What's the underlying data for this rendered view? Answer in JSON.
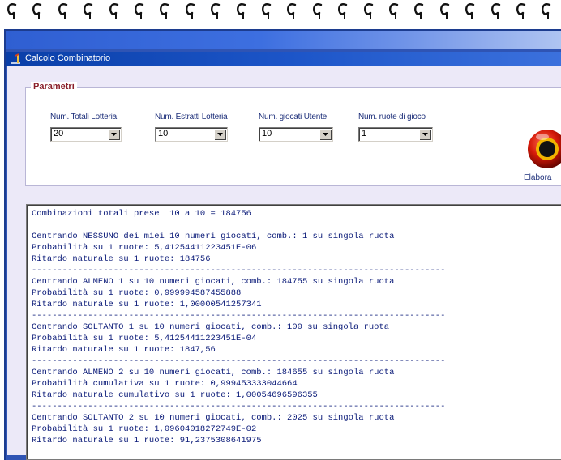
{
  "window": {
    "title": "Calcolo Combinatorio",
    "icon": "app-icon"
  },
  "params": {
    "legend": "Parametri",
    "fields": [
      {
        "label": "Num. Totali Lotteria",
        "value": "20"
      },
      {
        "label": "Num. Estratti Lotteria",
        "value": "10"
      },
      {
        "label": "Num. giocati Utente",
        "value": "10"
      },
      {
        "label": "Num. ruote di gioco",
        "value": "1"
      }
    ],
    "run_button": {
      "label": "Elabora",
      "icon": "run-orb-icon"
    }
  },
  "output": {
    "lines": [
      "Combinazioni totali prese  10 a 10 = 184756",
      "",
      "Centrando NESSUNO dei miei 10 numeri giocati, comb.: 1 su singola ruota",
      "Probabilità su 1 ruote: 5,41254411223451E-06",
      "Ritardo naturale su 1 ruote: 184756",
      "---------------------------------------------------------------------------------",
      "Centrando ALMENO 1 su 10 numeri giocati, comb.: 184755 su singola ruota",
      "Probabilità su 1 ruote: 0,999994587455888",
      "Ritardo naturale su 1 ruote: 1,00000541257341",
      "---------------------------------------------------------------------------------",
      "Centrando SOLTANTO 1 su 10 numeri giocati, comb.: 100 su singola ruota",
      "Probabilità su 1 ruote: 5,41254411223451E-04",
      "Ritardo naturale su 1 ruote: 1847,56",
      "---------------------------------------------------------------------------------",
      "Centrando ALMENO 2 su 10 numeri giocati, comb.: 184655 su singola ruota",
      "Probabilità cumulativa su 1 ruote: 0,999453333044664",
      "Ritardo naturale cumulativo su 1 ruote: 1,00054696596355",
      "---------------------------------------------------------------------------------",
      "Centrando SOLTANTO 2 su 10 numeri giocati, comb.: 2025 su singola ruota",
      "Probabilità su 1 ruote: 1,09604018272749E-02",
      "Ritardo naturale su 1 ruote: 91,2375308641975"
    ]
  },
  "colors": {
    "window_blue": "#2f54b4",
    "title_blue": "#0a3fa8",
    "output_text": "#0a1a78",
    "legend_text": "#8a1f2a"
  }
}
